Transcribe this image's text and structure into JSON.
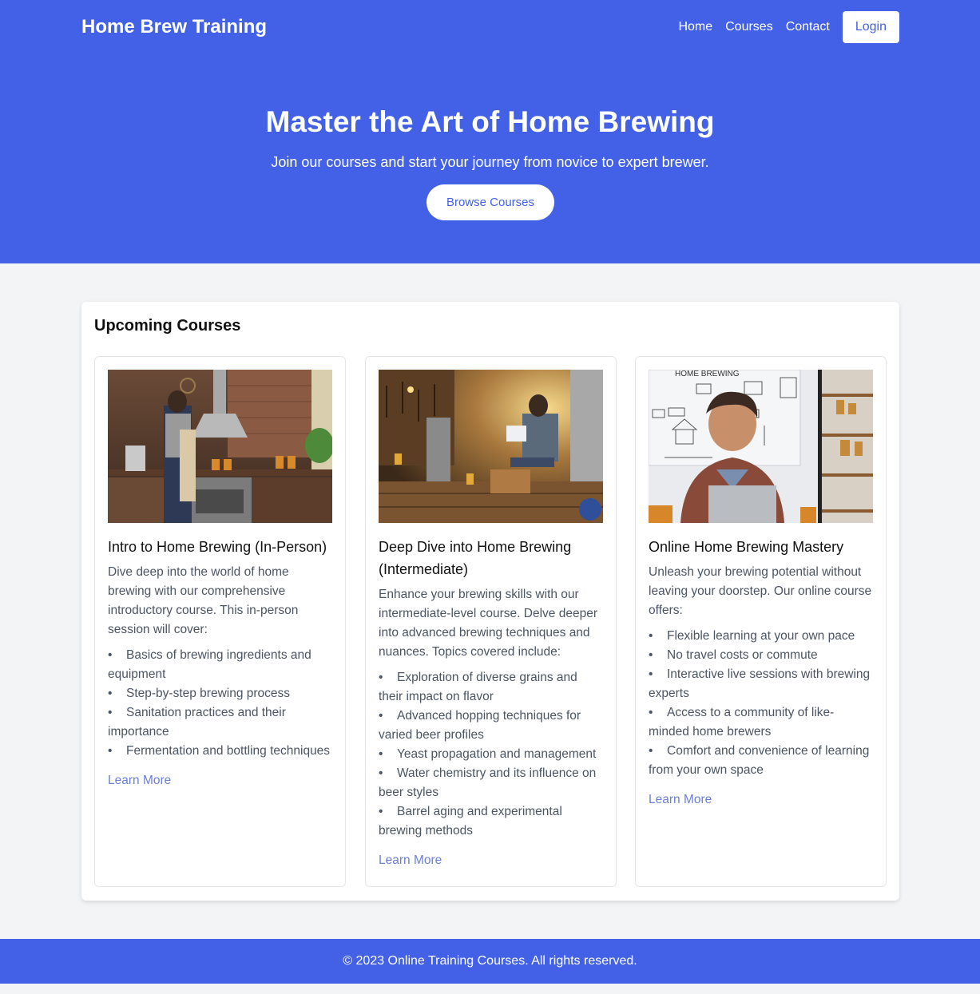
{
  "header": {
    "brand": "Home Brew Training",
    "nav": [
      "Home",
      "Courses",
      "Contact"
    ],
    "login": "Login"
  },
  "hero": {
    "title": "Master the Art of Home Brewing",
    "subtitle": "Join our courses and start your journey from novice to expert brewer.",
    "cta": "Browse Courses"
  },
  "courses": {
    "section_title": "Upcoming Courses",
    "items": [
      {
        "title": "Intro to Home Brewing (In-Person)",
        "description": "Dive deep into the world of home brewing with our comprehensive introductory course. This in-person session will cover:",
        "bullets": [
          "Basics of brewing ingredients and equipment",
          "Step-by-step brewing process",
          "Sanitation practices and their importance",
          "Fermentation and bottling techniques"
        ],
        "link": "Learn More",
        "image": "home-brewing-kitchen-photo"
      },
      {
        "title": "Deep Dive into Home Brewing (Intermediate)",
        "description": "Enhance your brewing skills with our intermediate-level course. Delve deeper into advanced brewing techniques and nuances. Topics covered include:",
        "bullets": [
          "Exploration of diverse grains and their impact on flavor",
          "Advanced hopping techniques for varied beer profiles",
          "Yeast propagation and management",
          "Water chemistry and its influence on beer styles",
          "Barrel aging and experimental brewing methods"
        ],
        "link": "Learn More",
        "image": "brewery-workshop-photo"
      },
      {
        "title": "Online Home Brewing Mastery",
        "description": "Unleash your brewing potential without leaving your doorstep. Our online course offers:",
        "bullets": [
          "Flexible learning at your own pace",
          "No travel costs or commute",
          "Interactive live sessions with brewing experts",
          "Access to a community of like-minded home brewers",
          "Comfort and convenience of learning from your own space"
        ],
        "link": "Learn More",
        "image": "online-learning-photo",
        "image_text": "HOME BREWING"
      }
    ]
  },
  "footer": {
    "copyright": "© 2023 Online Training Courses. All rights reserved."
  },
  "colors": {
    "primary": "#4361e6",
    "background": "#f3f4f6",
    "link": "#6b7fd7"
  }
}
